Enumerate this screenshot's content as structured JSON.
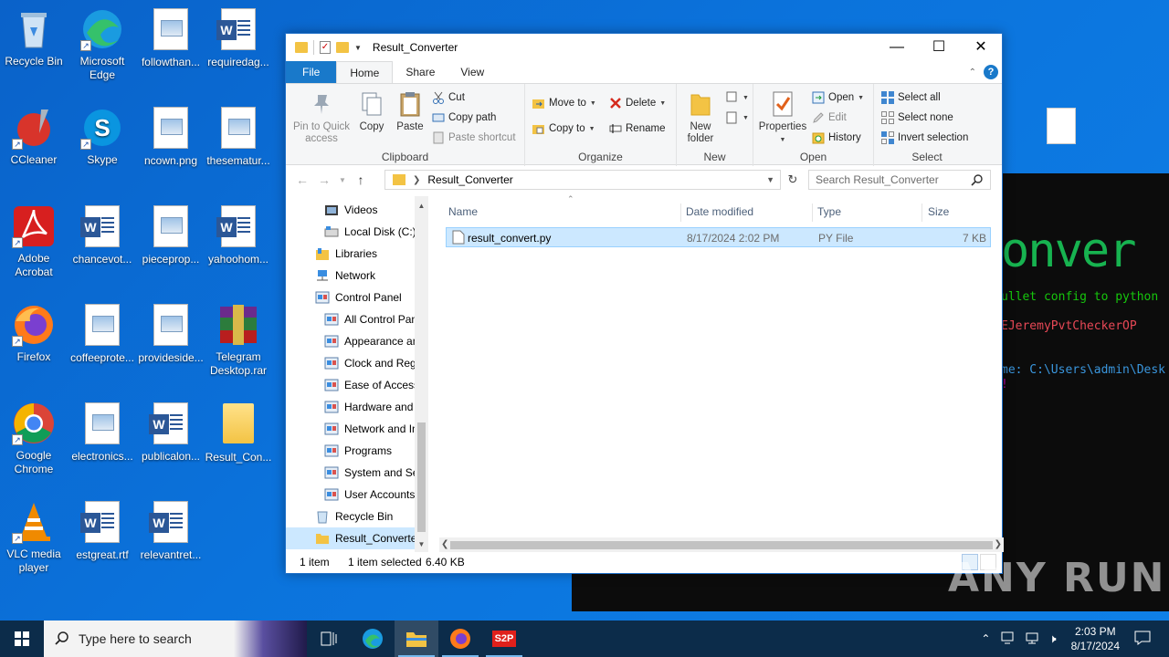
{
  "desktop": {
    "icons": [
      {
        "label": "Recycle Bin"
      },
      {
        "label": "Microsoft Edge"
      },
      {
        "label": "followthan..."
      },
      {
        "label": "requiredag..."
      },
      {
        "label": "CCleaner"
      },
      {
        "label": "Skype"
      },
      {
        "label": "ncown.png"
      },
      {
        "label": "thesematur..."
      },
      {
        "label": "Adobe Acrobat"
      },
      {
        "label": "chancevot..."
      },
      {
        "label": "pieceprop..."
      },
      {
        "label": "yahoohom..."
      },
      {
        "label": "Firefox"
      },
      {
        "label": "coffeeprote..."
      },
      {
        "label": "provideside..."
      },
      {
        "label": "Telegram Desktop.rar"
      },
      {
        "label": "Google Chrome"
      },
      {
        "label": "electronics..."
      },
      {
        "label": "publicalon..."
      },
      {
        "label": "Result_Con..."
      },
      {
        "label": "VLC media player"
      },
      {
        "label": "estgreat.rtf"
      },
      {
        "label": "relevantret..."
      }
    ]
  },
  "terminal": {
    "lines": [
      {
        "text": "ullet config to python",
        "color": "#16c60c"
      },
      {
        "text": "EJeremyPvtCheckerOP",
        "color": "#e74856"
      },
      {
        "text": "me: C:\\Users\\admin\\Desk",
        "color": "#3a96dd"
      },
      {
        "text": "!",
        "color": "#b4009e"
      }
    ],
    "ascii": "onver"
  },
  "explorer": {
    "title": "Result_Converter",
    "tabs": {
      "file": "File",
      "home": "Home",
      "share": "Share",
      "view": "View"
    },
    "ribbon": {
      "clipboard": {
        "pin": "Pin to Quick access",
        "copy": "Copy",
        "paste": "Paste",
        "cut": "Cut",
        "copy_path": "Copy path",
        "paste_shortcut": "Paste shortcut",
        "group": "Clipboard"
      },
      "organize": {
        "move_to": "Move to",
        "copy_to": "Copy to",
        "delete": "Delete",
        "rename": "Rename",
        "group": "Organize"
      },
      "new": {
        "new_folder": "New folder",
        "group": "New"
      },
      "open": {
        "properties": "Properties",
        "open": "Open",
        "edit": "Edit",
        "history": "History",
        "group": "Open"
      },
      "select": {
        "select_all": "Select all",
        "select_none": "Select none",
        "invert": "Invert selection",
        "group": "Select"
      }
    },
    "address": {
      "path": "Result_Converter",
      "search_placeholder": "Search Result_Converter"
    },
    "nav": [
      {
        "label": "Videos",
        "indent": 1
      },
      {
        "label": "Local Disk (C:)",
        "indent": 1
      },
      {
        "label": "Libraries",
        "indent": 0
      },
      {
        "label": "Network",
        "indent": 0
      },
      {
        "label": "Control Panel",
        "indent": 0
      },
      {
        "label": "All Control Panel Items",
        "indent": 1
      },
      {
        "label": "Appearance and Personalization",
        "indent": 1
      },
      {
        "label": "Clock and Region",
        "indent": 1
      },
      {
        "label": "Ease of Access",
        "indent": 1
      },
      {
        "label": "Hardware and Sound",
        "indent": 1
      },
      {
        "label": "Network and Internet",
        "indent": 1
      },
      {
        "label": "Programs",
        "indent": 1
      },
      {
        "label": "System and Security",
        "indent": 1
      },
      {
        "label": "User Accounts",
        "indent": 1
      },
      {
        "label": "Recycle Bin",
        "indent": 0
      },
      {
        "label": "Result_Converter",
        "indent": 0,
        "selected": true
      }
    ],
    "columns": {
      "name": "Name",
      "date": "Date modified",
      "type": "Type",
      "size": "Size"
    },
    "files": [
      {
        "name": "result_convert.py",
        "date": "8/17/2024 2:02 PM",
        "type": "PY File",
        "size": "7 KB"
      }
    ],
    "status": {
      "count": "1 item",
      "selected": "1 item selected",
      "size": "6.40 KB"
    }
  },
  "taskbar": {
    "search_placeholder": "Type here to search",
    "time": "2:03 PM",
    "date": "8/17/2024",
    "s2p_label": "S2P"
  },
  "watermark": "ANY RUN"
}
